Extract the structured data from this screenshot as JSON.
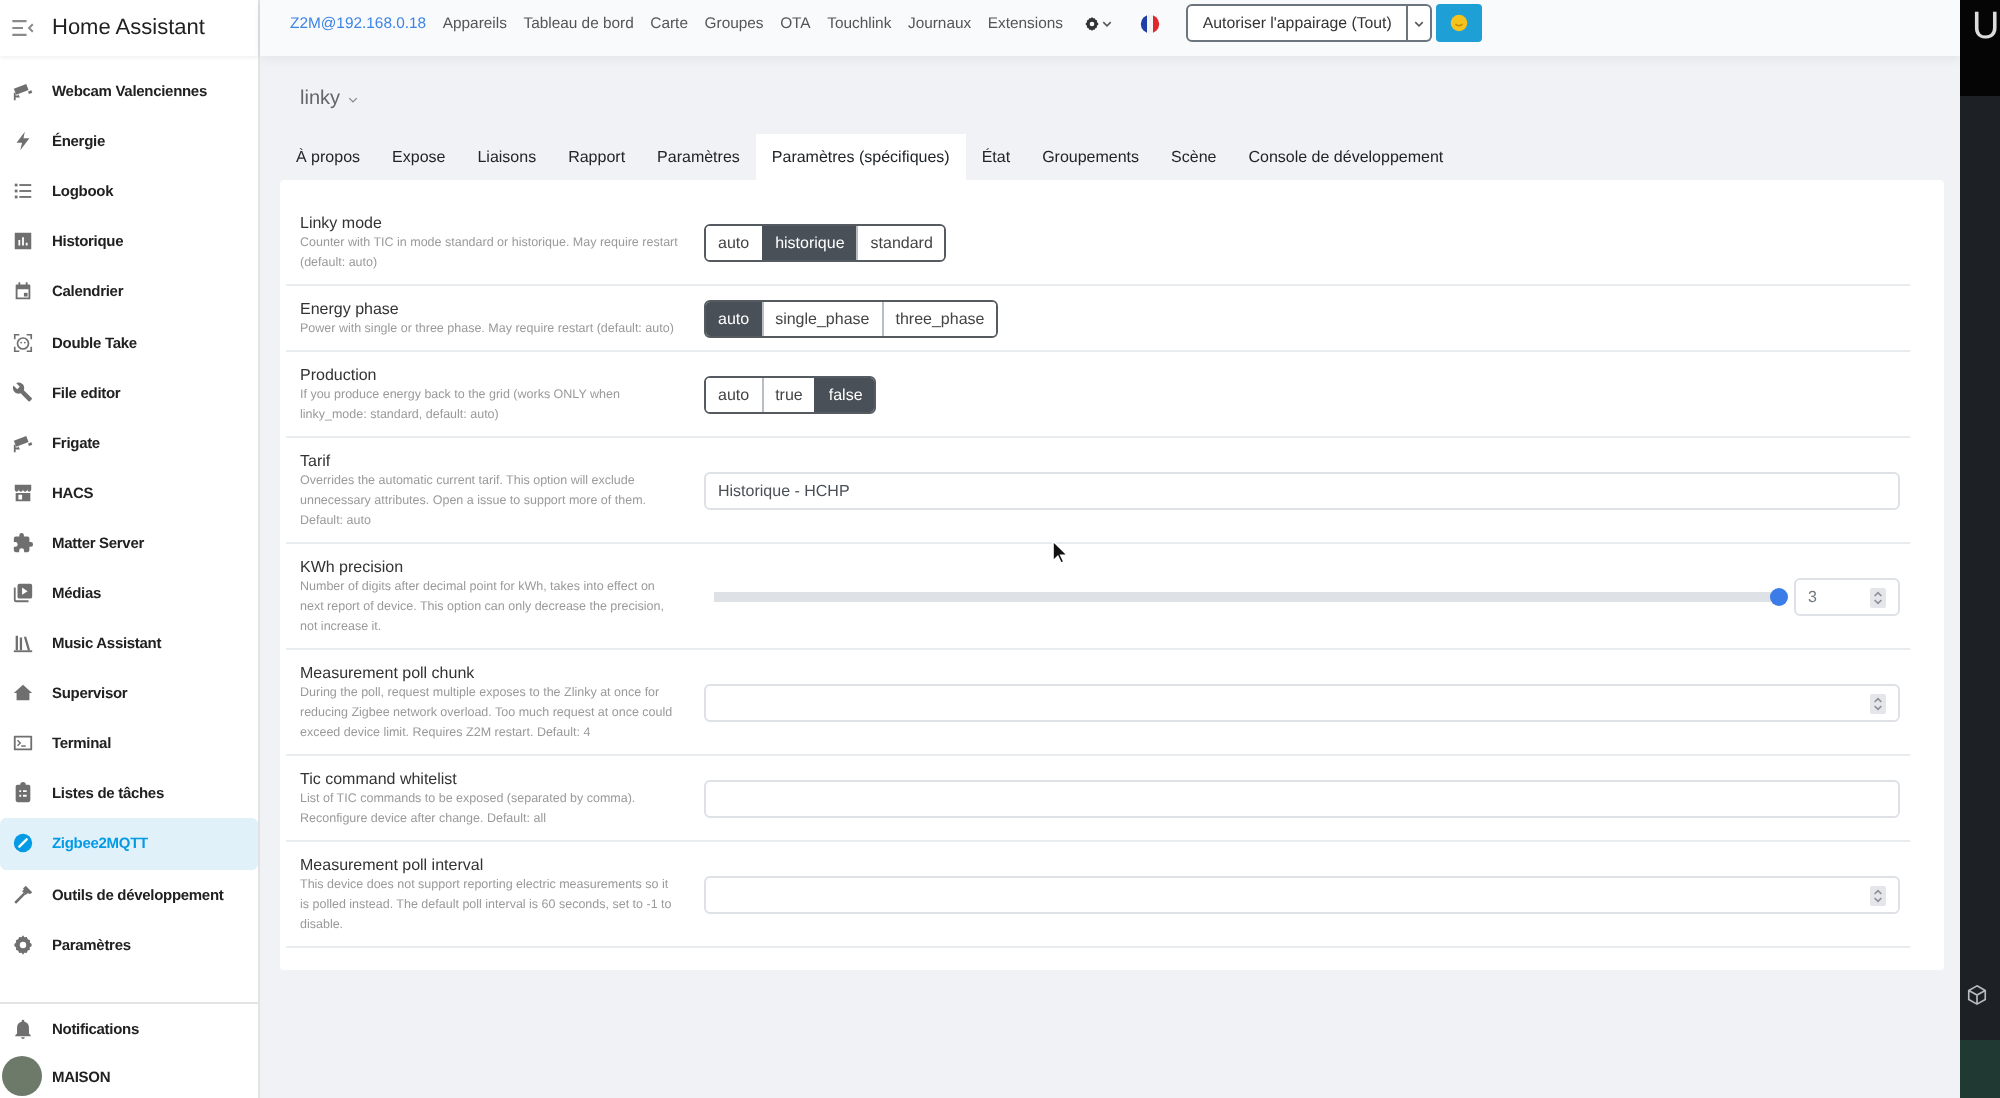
{
  "sidebar": {
    "title": "Home Assistant",
    "items": [
      {
        "label": "Webcam Valenciennes",
        "selected": false
      },
      {
        "label": "Énergie",
        "selected": false
      },
      {
        "label": "Logbook",
        "selected": false
      },
      {
        "label": "Historique",
        "selected": false
      },
      {
        "label": "Calendrier",
        "selected": false
      },
      {
        "label": "Double Take",
        "selected": false
      },
      {
        "label": "File editor",
        "selected": false
      },
      {
        "label": "Frigate",
        "selected": false
      },
      {
        "label": "HACS",
        "selected": false
      },
      {
        "label": "Matter Server",
        "selected": false
      },
      {
        "label": "Médias",
        "selected": false
      },
      {
        "label": "Music Assistant",
        "selected": false
      },
      {
        "label": "Supervisor",
        "selected": false
      },
      {
        "label": "Terminal",
        "selected": false
      },
      {
        "label": "Listes de tâches",
        "selected": false
      },
      {
        "label": "Zigbee2MQTT",
        "selected": true
      },
      {
        "label": "Outils de développement",
        "selected": false
      },
      {
        "label": "Paramètres",
        "selected": false
      }
    ],
    "footer": [
      {
        "label": "Notifications"
      },
      {
        "label": "MAISON"
      }
    ]
  },
  "navbar": {
    "brand": "Z2M@192.168.0.18",
    "links": [
      "Appareils",
      "Tableau de bord",
      "Carte",
      "Groupes",
      "OTA",
      "Touchlink",
      "Journaux",
      "Extensions"
    ],
    "pairing_button": "Autoriser l'appairage (Tout)"
  },
  "device": {
    "name": "linky"
  },
  "tabs": [
    {
      "label": "À propos",
      "selected": false
    },
    {
      "label": "Expose",
      "selected": false
    },
    {
      "label": "Liaisons",
      "selected": false
    },
    {
      "label": "Rapport",
      "selected": false
    },
    {
      "label": "Paramètres",
      "selected": false
    },
    {
      "label": "Paramètres (spécifiques)",
      "selected": true
    },
    {
      "label": "État",
      "selected": false
    },
    {
      "label": "Groupements",
      "selected": false
    },
    {
      "label": "Scène",
      "selected": false
    },
    {
      "label": "Console de développement",
      "selected": false
    }
  ],
  "settings": [
    {
      "kind": "buttons",
      "title": "Linky mode",
      "description": "Counter with TIC in mode standard or historique. May require restart (default: auto)",
      "options": [
        {
          "label": "auto",
          "selected": false
        },
        {
          "label": "historique",
          "selected": true
        },
        {
          "label": "standard",
          "selected": false
        }
      ]
    },
    {
      "kind": "buttons",
      "title": "Energy phase",
      "description": "Power with single or three phase. May require restart (default: auto)",
      "options": [
        {
          "label": "auto",
          "selected": true
        },
        {
          "label": "single_phase",
          "selected": false
        },
        {
          "label": "three_phase",
          "selected": false
        }
      ]
    },
    {
      "kind": "buttons",
      "title": "Production",
      "description": "If you produce energy back to the grid (works ONLY when linky_mode: standard, default: auto)",
      "options": [
        {
          "label": "auto",
          "selected": false
        },
        {
          "label": "true",
          "selected": false
        },
        {
          "label": "false",
          "selected": true
        }
      ]
    },
    {
      "kind": "text",
      "title": "Tarif",
      "description": "Overrides the automatic current tarif. This option will exclude unnecessary attributes. Open a issue to support more of them. Default: auto",
      "value": "Historique - HCHP"
    },
    {
      "kind": "slider",
      "title": "KWh precision",
      "description": "Number of digits after decimal point for kWh, takes into effect on next report of device. This option can only decrease the precision, not increase it.",
      "level": 1,
      "value": "3"
    },
    {
      "kind": "number",
      "title": "Measurement poll chunk",
      "description": "During the poll, request multiple exposes to the Zlinky at once for reducing Zigbee network overload. Too much request at once could exceed device limit. Requires Z2M restart. Default: 4"
    },
    {
      "kind": "text",
      "title": "Tic command whitelist",
      "description": "List of TIC commands to be exposed (separated by comma). Reconfigure device after change. Default: all"
    },
    {
      "kind": "number",
      "title": "Measurement poll interval",
      "description": "This device does not support reporting electric measurements so it is polled instead. The default poll interval is 60 seconds, set to -1 to disable."
    }
  ],
  "side_window": {
    "title": "U"
  }
}
